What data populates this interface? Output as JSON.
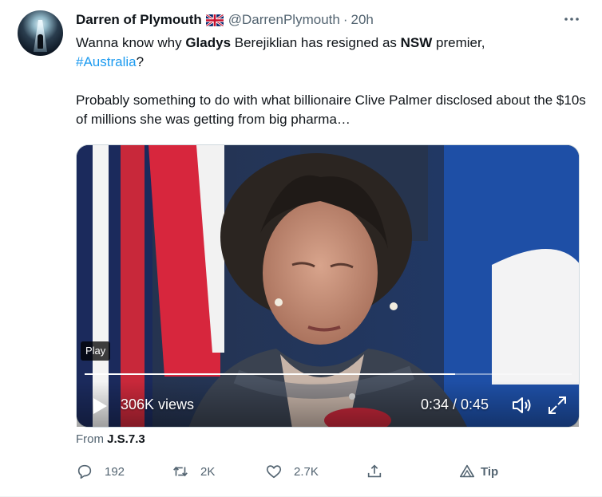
{
  "tweet": {
    "author_name": "Darren of Plymouth",
    "author_handle": "@DarrenPlymouth",
    "separator": "·",
    "time_ago": "20h",
    "text_line1_a": "Wanna know why ",
    "text_bold1": "Gladys",
    "text_line1_b": " Berejiklian has resigned as ",
    "text_bold2": "NSW",
    "text_line1_c": " premier,",
    "hashtag": "#Australia",
    "text_line2_suffix": "?",
    "text_para2": "Probably something to do with what billionaire Clive Palmer disclosed about the $10s of millions she was getting from big pharma…",
    "source_prefix": "From ",
    "source_name": "J.S.7.3"
  },
  "video": {
    "tooltip": "Play",
    "views": "306K views",
    "time": "0:34 / 0:45",
    "progress": 0.76
  },
  "actions": {
    "replies": "192",
    "retweets": "2K",
    "likes": "2.7K",
    "tip": "Tip"
  },
  "colors": {
    "accent": "#1d9bf0",
    "secondary_text": "#536471",
    "primary_text": "#0f1419"
  },
  "icons": [
    "avatar",
    "uk-flag-icon",
    "more-icon",
    "play-icon",
    "volume-icon",
    "fullscreen-icon",
    "reply-icon",
    "retweet-icon",
    "like-icon",
    "share-icon",
    "tip-icon"
  ]
}
